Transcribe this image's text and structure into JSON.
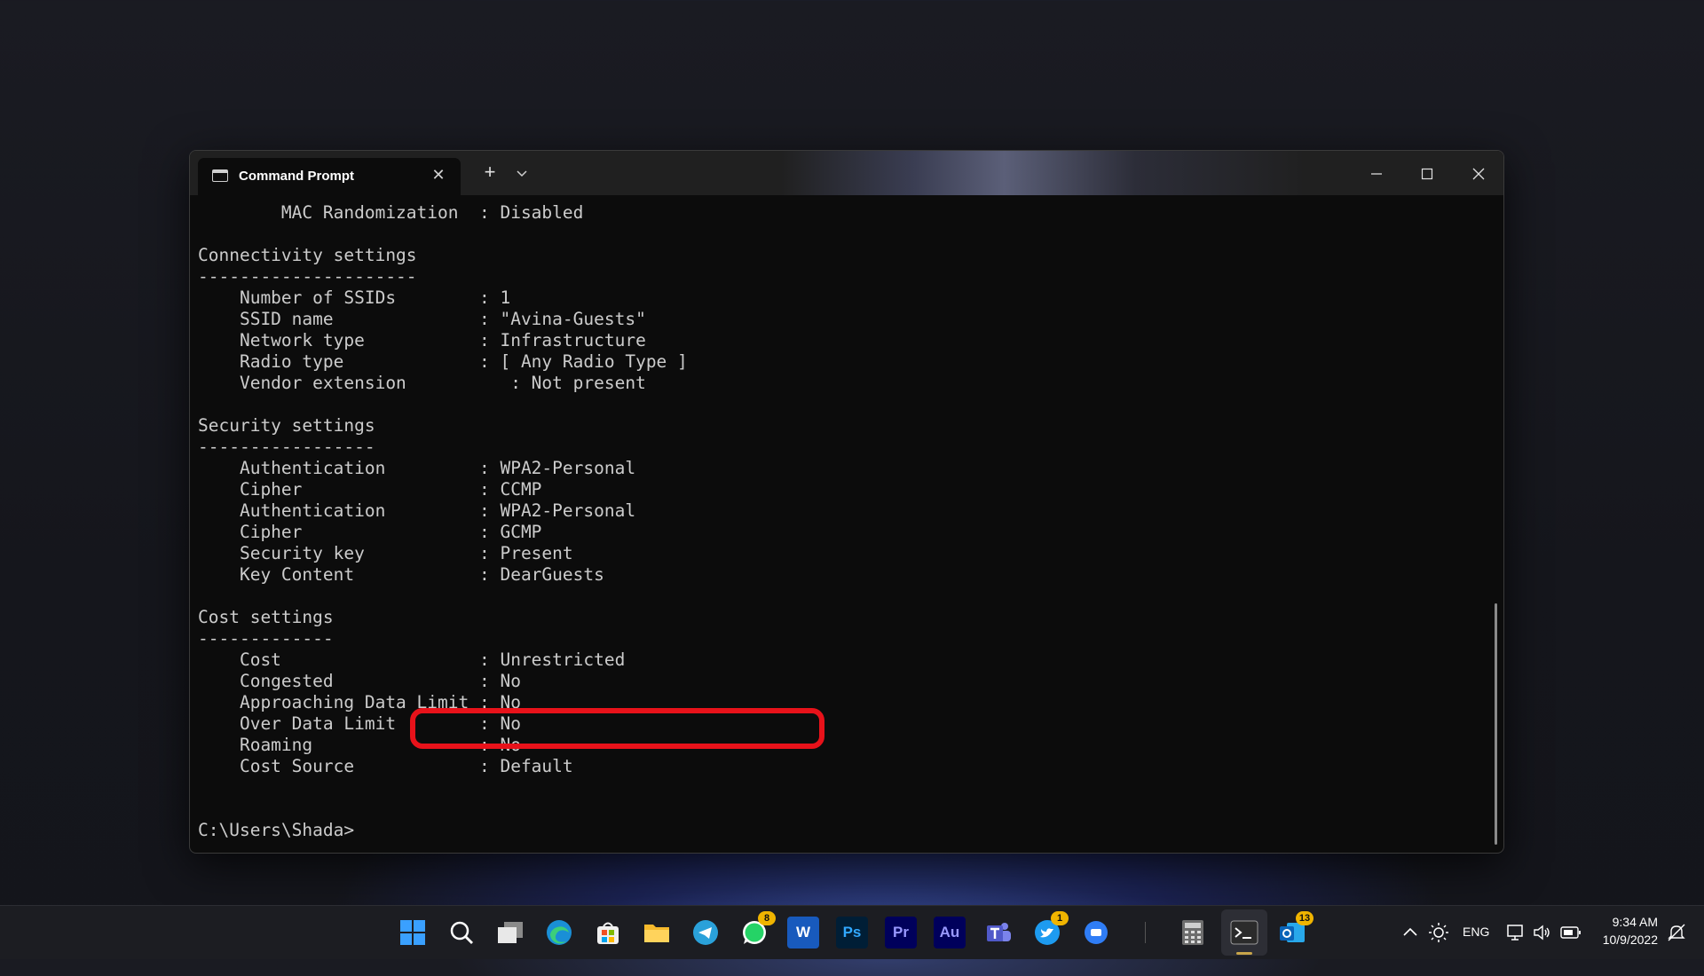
{
  "window": {
    "tab_title": "Command Prompt",
    "tab_close": "✕",
    "new_tab": "+",
    "icons": [
      "console-icon",
      "close-icon",
      "plus-icon",
      "chevron-down-icon",
      "minimize-icon",
      "maximize-icon",
      "close-icon"
    ]
  },
  "console": {
    "lines": [
      "        MAC Randomization  : Disabled",
      "",
      "Connectivity settings",
      "---------------------",
      "    Number of SSIDs        : 1",
      "    SSID name              : \"Avina-Guests\"",
      "    Network type           : Infrastructure",
      "    Radio type             : [ Any Radio Type ]",
      "    Vendor extension          : Not present",
      "",
      "Security settings",
      "-----------------",
      "    Authentication         : WPA2-Personal",
      "    Cipher                 : CCMP",
      "    Authentication         : WPA2-Personal",
      "    Cipher                 : GCMP",
      "    Security key           : Present",
      "    Key Content            : DearGuests",
      "",
      "Cost settings",
      "-------------",
      "    Cost                   : Unrestricted",
      "    Congested              : No",
      "    Approaching Data Limit : No",
      "    Over Data Limit        : No",
      "    Roaming                : No",
      "    Cost Source            : Default",
      "",
      "",
      "C:\\Users\\Shada>"
    ],
    "highlight_color": "#e8121a"
  },
  "taskbar": {
    "apps": [
      {
        "name": "start-icon"
      },
      {
        "name": "search-icon"
      },
      {
        "name": "task-view-icon"
      },
      {
        "name": "edge-icon"
      },
      {
        "name": "store-icon"
      },
      {
        "name": "file-explorer-icon"
      },
      {
        "name": "telegram-icon"
      },
      {
        "name": "whatsapp-icon",
        "badge": "8"
      },
      {
        "name": "word-icon",
        "label": "W"
      },
      {
        "name": "photoshop-icon",
        "label": "Ps"
      },
      {
        "name": "premiere-icon",
        "label": "Pr"
      },
      {
        "name": "audition-icon",
        "label": "Au"
      },
      {
        "name": "teams-icon"
      },
      {
        "name": "twitter-icon",
        "badge": "1"
      },
      {
        "name": "messenger-icon"
      },
      {
        "name": "calculator-icon"
      },
      {
        "name": "terminal-icon"
      },
      {
        "name": "outlook-icon",
        "badge": "13"
      }
    ],
    "tray": {
      "language": "ENG",
      "time": "9:34 AM",
      "date": "10/9/2022"
    }
  }
}
